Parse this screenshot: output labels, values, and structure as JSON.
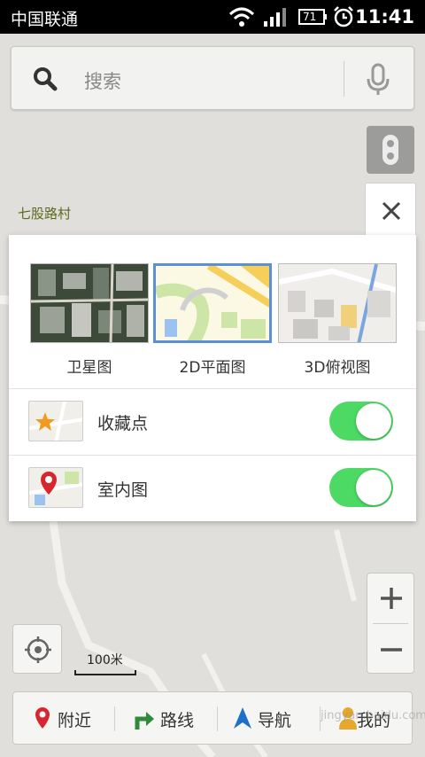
{
  "status_bar": {
    "carrier": "中国联通",
    "battery": "71",
    "time": "11:41"
  },
  "map": {
    "place_label": "七股路村"
  },
  "search": {
    "placeholder": "搜索"
  },
  "layer_panel": {
    "map_types": [
      {
        "label": "卫星图",
        "selected": false
      },
      {
        "label": "2D平面图",
        "selected": true
      },
      {
        "label": "3D俯视图",
        "selected": false
      }
    ],
    "toggles": [
      {
        "label": "收藏点",
        "on": true
      },
      {
        "label": "室内图",
        "on": true
      }
    ]
  },
  "scale": {
    "label": "100米"
  },
  "bottom_nav": {
    "items": [
      {
        "label": "附近",
        "icon": "location-pin-icon"
      },
      {
        "label": "路线",
        "icon": "route-arrow-icon"
      },
      {
        "label": "导航",
        "icon": "navigation-arrow-icon"
      },
      {
        "label": "我的",
        "icon": "person-icon"
      }
    ]
  },
  "watermark": "jingyan.baidu.com",
  "colors": {
    "toggle_on": "#4cd964",
    "selected_border": "#5b8fd8"
  }
}
